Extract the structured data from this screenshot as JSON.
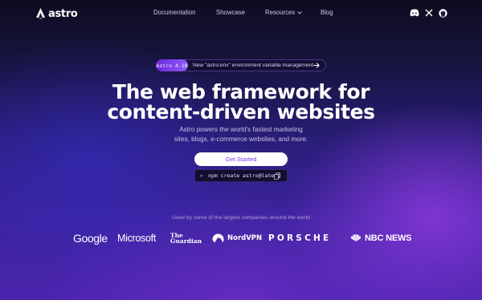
{
  "nav": {
    "logo_text": "astro",
    "links": [
      "Documentation",
      "Showcase",
      "Resources",
      "Blog"
    ],
    "social_icons": [
      "discord-icon",
      "x-icon",
      "github-icon"
    ]
  },
  "announcement": {
    "badge": "Astro 4.10",
    "text": "New \"astro:env\" environment variable management"
  },
  "hero": {
    "headline_line1": "The web framework for",
    "headline_line2": "content-driven websites",
    "subtitle_line1": "Astro powers the world's fastest marketing",
    "subtitle_line2": "sites, blogs, e-commerce websites, and more.",
    "cta_label": "Get Started",
    "command_prompt": ">",
    "command": "npm create astro@latest"
  },
  "customers": {
    "caption": "Used by some of the largest companies around the world",
    "logos": {
      "google": "Google",
      "microsoft": "Microsoft",
      "guardian_line1": "The",
      "guardian_line2": "Guardian",
      "nordvpn": "NordVPN",
      "porsche": "PORSCHE",
      "nbc": "NBC NEWS"
    }
  },
  "colors": {
    "accent": "#7c3aed",
    "badge": "#8b5cf6",
    "background_top": "#0e0c1f",
    "background_bottom": "#4a24ad"
  }
}
